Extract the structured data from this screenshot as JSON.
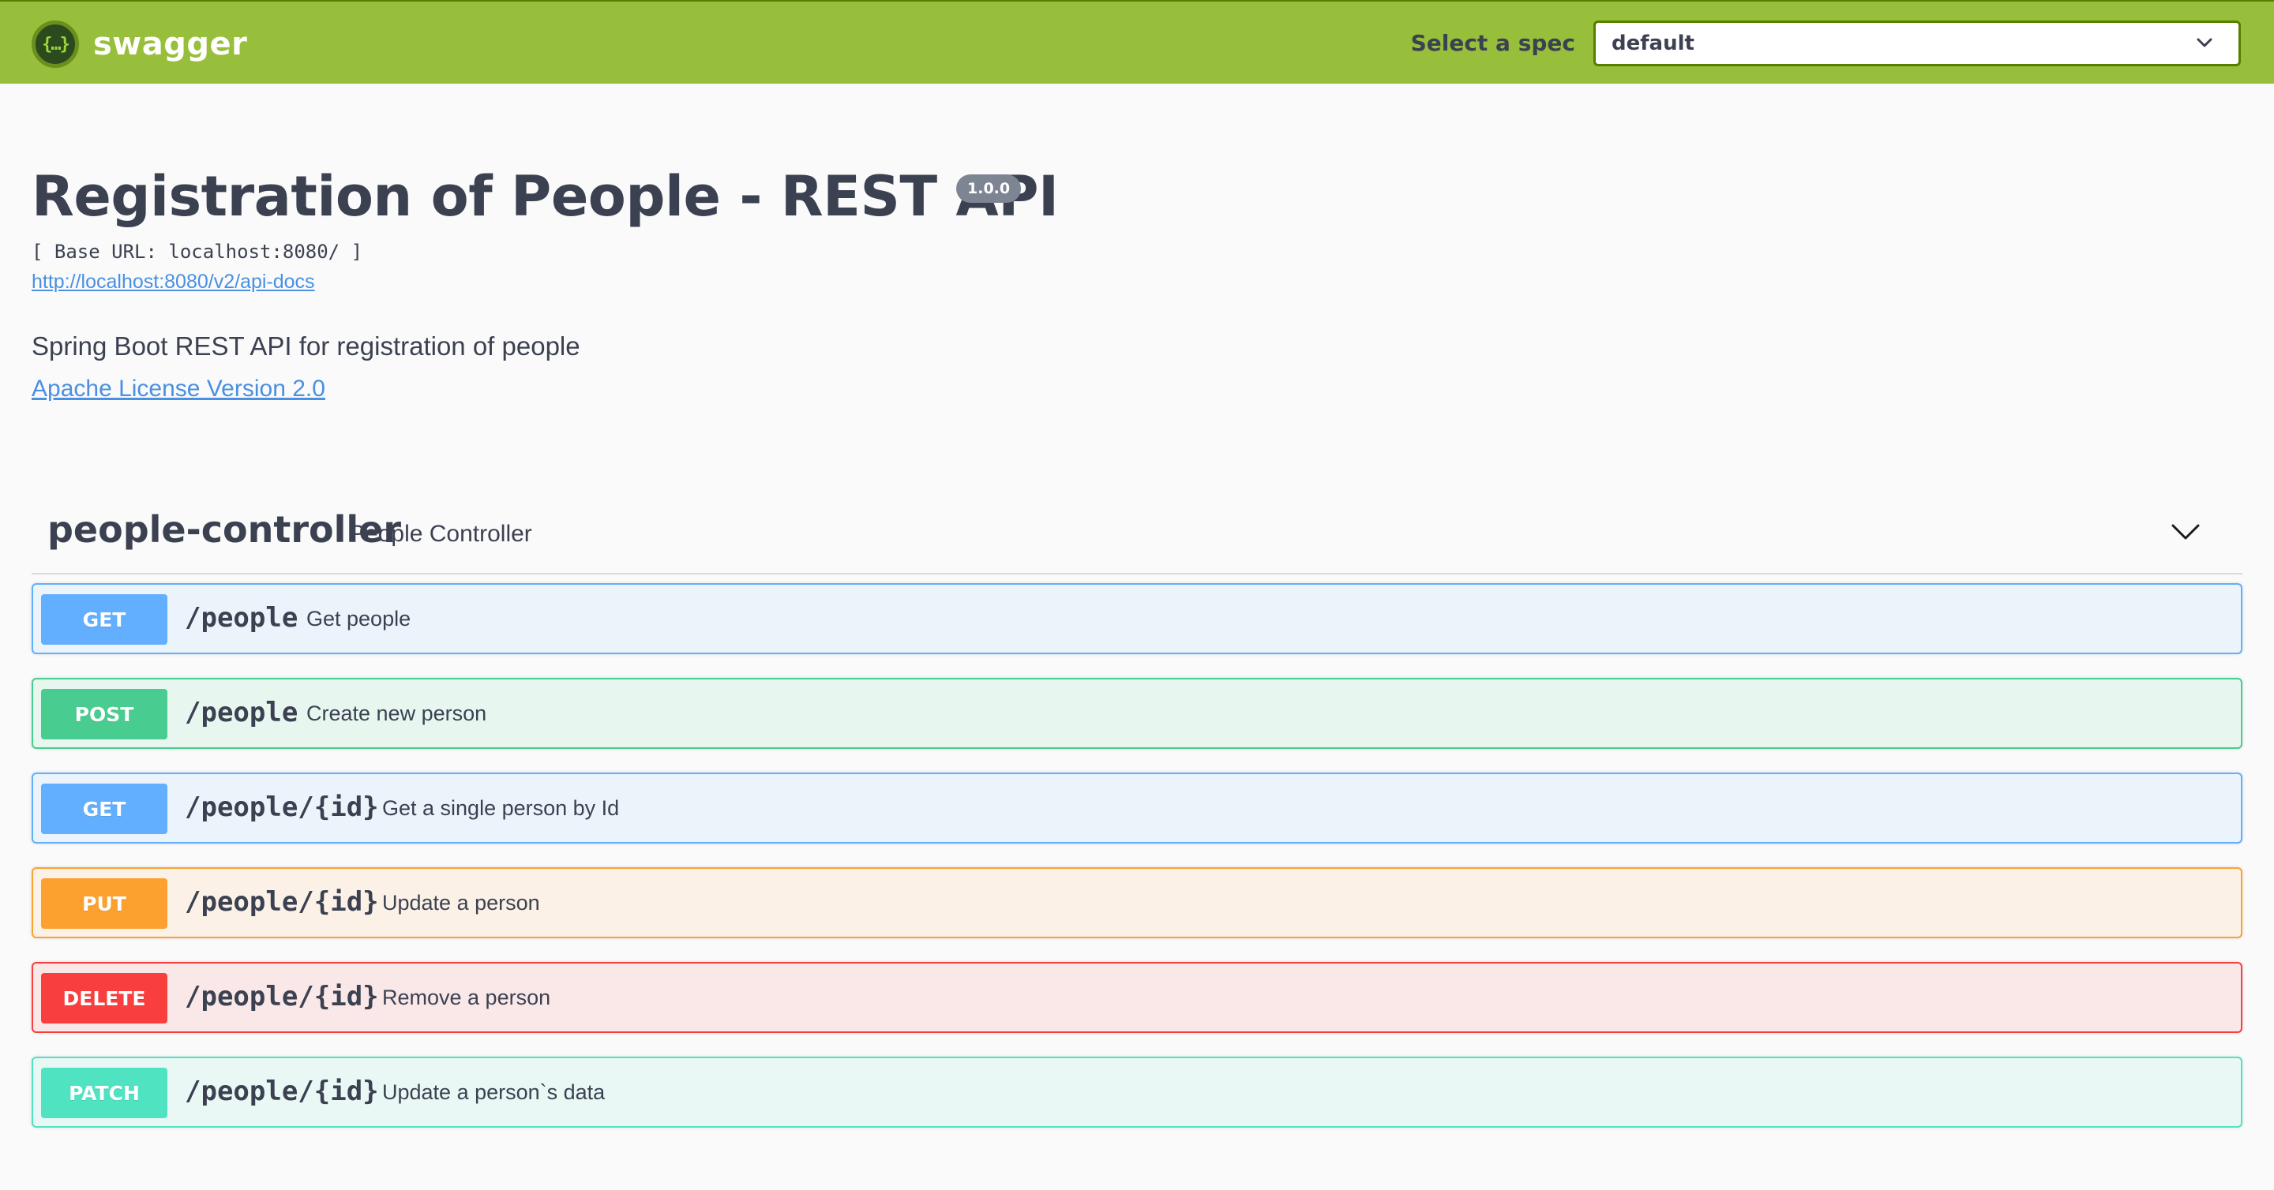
{
  "topbar": {
    "logo_text": "swagger",
    "logo_icon_glyph": "{…}",
    "spec_label": "Select a spec",
    "spec_selected": "default",
    "accent_color": "#89bf04"
  },
  "info": {
    "title": "Registration of People - REST API",
    "version": "1.0.0",
    "base_url": "[ Base URL: localhost:8080/ ]",
    "api_docs_url": "http://localhost:8080/v2/api-docs",
    "description": "Spring Boot REST API for registration of people",
    "license": "Apache License Version 2.0"
  },
  "tag": {
    "name": "people-controller",
    "description": "People Controller",
    "toggle_icon": "chevron-down-icon"
  },
  "operations": [
    {
      "method": "GET",
      "path": "/people",
      "summary": "Get people",
      "color": "#61affe"
    },
    {
      "method": "POST",
      "path": "/people",
      "summary": "Create new person",
      "color": "#49cc90"
    },
    {
      "method": "GET",
      "path": "/people/{id}",
      "summary": "Get a single person by Id",
      "color": "#61affe"
    },
    {
      "method": "PUT",
      "path": "/people/{id}",
      "summary": "Update a person",
      "color": "#fca130"
    },
    {
      "method": "DELETE",
      "path": "/people/{id}",
      "summary": "Remove a person",
      "color": "#f93e3e"
    },
    {
      "method": "PATCH",
      "path": "/people/{id}",
      "summary": "Update a person`s data",
      "color": "#50e3c2"
    }
  ]
}
